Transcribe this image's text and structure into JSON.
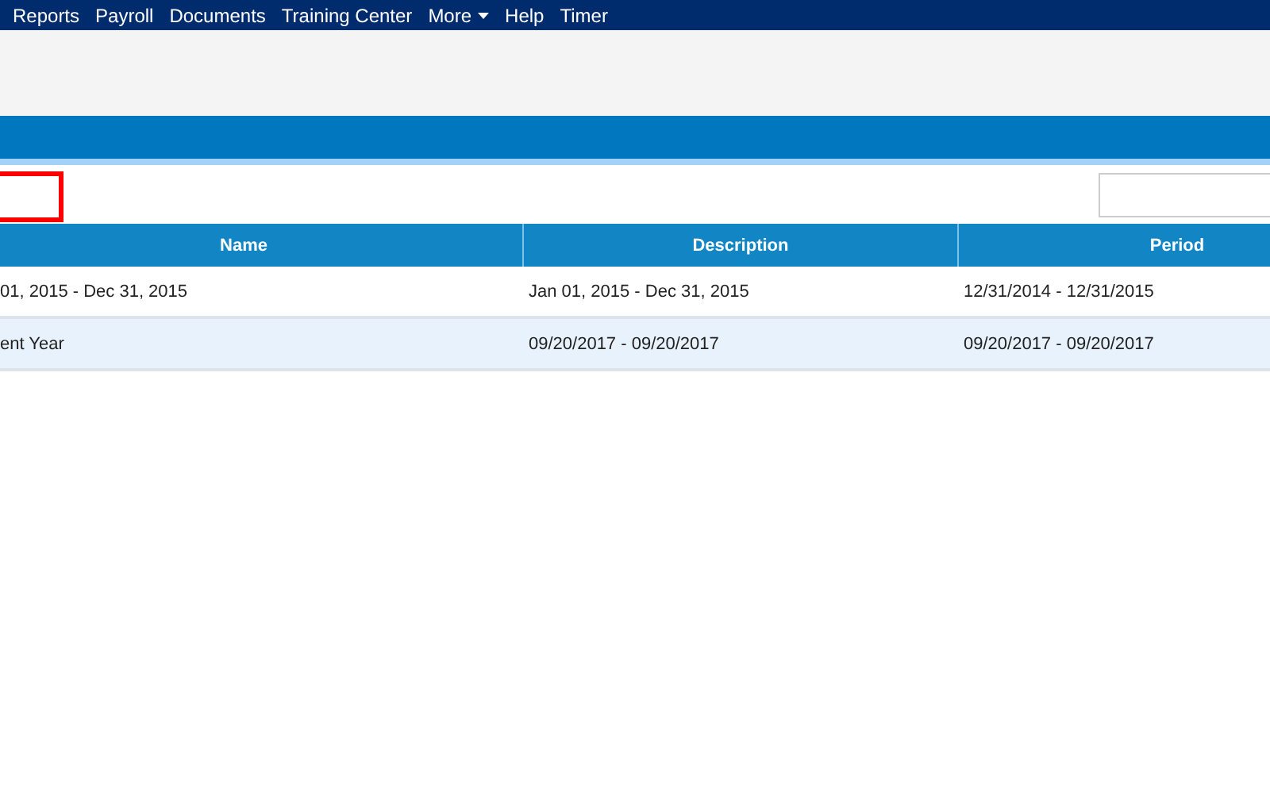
{
  "nav": {
    "items": [
      {
        "label": "Reports",
        "dropdown": false
      },
      {
        "label": "Payroll",
        "dropdown": false
      },
      {
        "label": "Documents",
        "dropdown": false
      },
      {
        "label": "Training Center",
        "dropdown": false
      },
      {
        "label": "More",
        "dropdown": true
      },
      {
        "label": "Help",
        "dropdown": false
      },
      {
        "label": "Timer",
        "dropdown": false
      }
    ]
  },
  "table": {
    "columns": [
      "Name",
      "Description",
      "Period"
    ],
    "rows": [
      {
        "cells": [
          "01, 2015 - Dec 31, 2015",
          "Jan 01, 2015 - Dec 31, 2015",
          "12/31/2014 - 12/31/2015"
        ],
        "striped": false
      },
      {
        "cells": [
          "ent Year",
          "09/20/2017 - 09/20/2017",
          "09/20/2017 - 09/20/2017"
        ],
        "striped": true
      }
    ]
  }
}
